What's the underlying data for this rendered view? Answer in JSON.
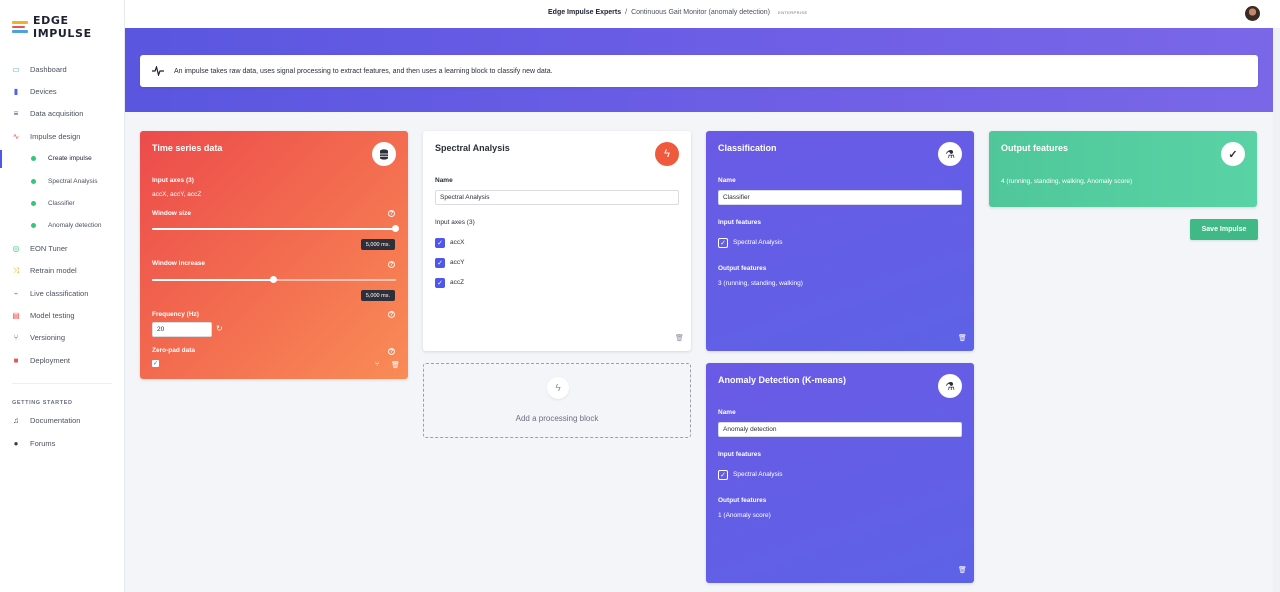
{
  "app": {
    "logo_text": "EDGE IMPULSE"
  },
  "sidebar": {
    "items": [
      {
        "label": "Dashboard",
        "icon": "monitor-icon",
        "color": "#4aa3df"
      },
      {
        "label": "Devices",
        "icon": "chip-icon",
        "color": "#5561e8"
      },
      {
        "label": "Data acquisition",
        "icon": "database-icon",
        "color": "#3b3f9f"
      },
      {
        "label": "Impulse design",
        "icon": "pulse-icon",
        "color": "#ea5252"
      }
    ],
    "sub_items": [
      {
        "label": "Create impulse",
        "active": true
      },
      {
        "label": "Spectral Analysis"
      },
      {
        "label": "Classifier"
      },
      {
        "label": "Anomaly detection"
      }
    ],
    "items2": [
      {
        "label": "EON Tuner",
        "icon": "target-icon",
        "color": "#34c77b"
      },
      {
        "label": "Retrain model",
        "icon": "shuffle-icon",
        "color": "#f1b21c"
      },
      {
        "label": "Live classification",
        "icon": "live-icon",
        "color": "#34c77b"
      },
      {
        "label": "Model testing",
        "icon": "clipboard-icon",
        "color": "#ea5252"
      },
      {
        "label": "Versioning",
        "icon": "branch-icon",
        "color": "#4e57e7"
      },
      {
        "label": "Deployment",
        "icon": "gift-icon",
        "color": "#ea5252"
      }
    ],
    "section_title": "GETTING STARTED",
    "items3": [
      {
        "label": "Documentation",
        "icon": "book-icon",
        "color": "#3b3f4f"
      },
      {
        "label": "Forums",
        "icon": "chat-icon",
        "color": "#3b3f4f"
      }
    ]
  },
  "header": {
    "org": "Edge Impulse Experts",
    "separator": "/",
    "project": "Continuous Gait Monitor (anomaly detection)",
    "badge": "ENTERPRISE"
  },
  "info_text": "An impulse takes raw data, uses signal processing to extract features, and then uses a learning block to classify new data.",
  "time_series": {
    "title": "Time series data",
    "input_axes_label": "Input axes (3)",
    "input_axes_value": "accX, accY, accZ",
    "window_size_label": "Window size",
    "window_size_value": "5,000 ms.",
    "window_size_level": 1.0,
    "window_increase_label": "Window increase",
    "window_increase_value": "5,000 ms.",
    "window_increase_level": 0.5,
    "frequency_label": "Frequency (Hz)",
    "frequency_value": "20",
    "zero_pad_label": "Zero-pad data",
    "zero_pad_checked": true
  },
  "spectral": {
    "title": "Spectral Analysis",
    "name_label": "Name",
    "name_value": "Spectral Analysis",
    "input_axes_label": "Input axes (3)",
    "axes": [
      "accX",
      "accY",
      "accZ"
    ]
  },
  "add_block": {
    "label": "Add a processing block"
  },
  "classification": {
    "title": "Classification",
    "name_label": "Name",
    "name_value": "Classifier",
    "input_features_label": "Input features",
    "input_feature": "Spectral Analysis",
    "output_features_label": "Output features",
    "output_features_value": "3 (running, standing, walking)"
  },
  "anomaly": {
    "title": "Anomaly Detection (K-means)",
    "name_label": "Name",
    "name_value": "Anomaly detection",
    "input_features_label": "Input features",
    "input_feature": "Spectral Analysis",
    "output_features_label": "Output features",
    "output_features_value": "1 (Anomaly score)"
  },
  "output": {
    "title": "Output features",
    "value": "4 (running, standing, walking, Anomaly score)"
  },
  "save_button": "Save Impulse"
}
